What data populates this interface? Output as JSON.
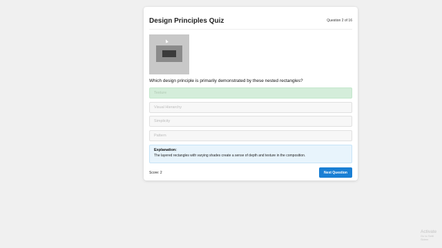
{
  "quiz": {
    "title": "Design Principles Quiz",
    "counter": "Question 2 of 16",
    "question": "Which design principle is primarily demonstrated by these nested rectangles?",
    "image_icon": "nested-rectangles-image",
    "options": [
      {
        "label": "Texture",
        "state": "correct"
      },
      {
        "label": "Visual Hierarchy",
        "state": "default"
      },
      {
        "label": "Simplicity",
        "state": "default"
      },
      {
        "label": "Pattern",
        "state": "default"
      }
    ],
    "explanation": {
      "title": "Explanation:",
      "text": "The layered rectangles with varying shades create a sense of depth and texture in the composition."
    },
    "score": "Score: 2",
    "next_label": "Next Question"
  },
  "watermark": {
    "line1": "Activate",
    "line2": "Go to Setti",
    "line3": "Sidem"
  },
  "colors": {
    "background": "#f0f0f0",
    "correct_bg": "#d4edda",
    "explanation_bg": "#e8f4fc",
    "primary_button": "#1a7fd4"
  }
}
